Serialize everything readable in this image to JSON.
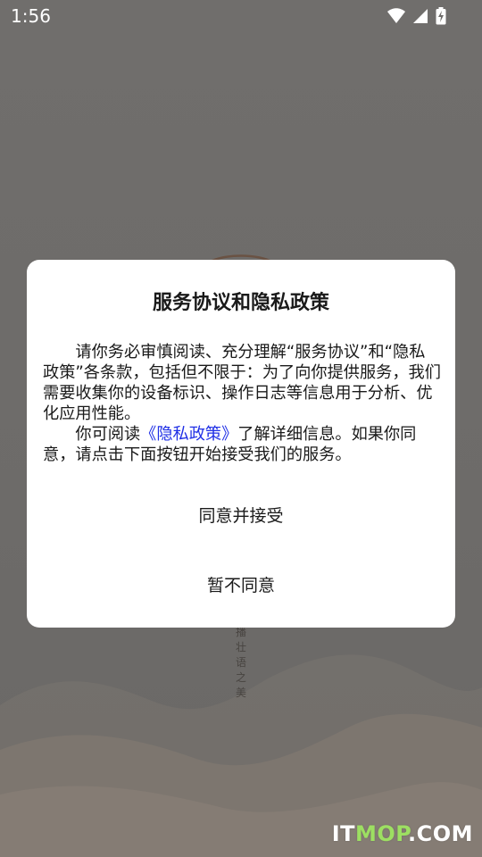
{
  "status_bar": {
    "time": "1:56",
    "icons": [
      "wifi-icon",
      "cellular-signal-icon",
      "battery-charging-icon"
    ]
  },
  "background": {
    "vertical_text": "播壮语之美",
    "watermark_prefix": "IT",
    "watermark_middle": "MOP",
    "watermark_suffix": ".COM"
  },
  "dialog": {
    "title": "服务协议和隐私政策",
    "paragraph1": "请你务必审慎阅读、充分理解“服务协议”和“隐私政策”各条款，包括但不限于：为了向你提供服务，我们需要收集你的设备标识、操作日志等信息用于分析、优化应用性能。",
    "paragraph2_before": "你可阅读",
    "policy_link": "《隐私政策》",
    "paragraph2_after": "了解详细信息。如果你同意，请点击下面按钮开始接受我们的服务。",
    "agree_button": "同意并接受",
    "decline_button": "暂不同意"
  },
  "colors": {
    "link": "#2030e6",
    "overlay": "#6e6c6a",
    "watermark_green": "#9ddf62"
  }
}
